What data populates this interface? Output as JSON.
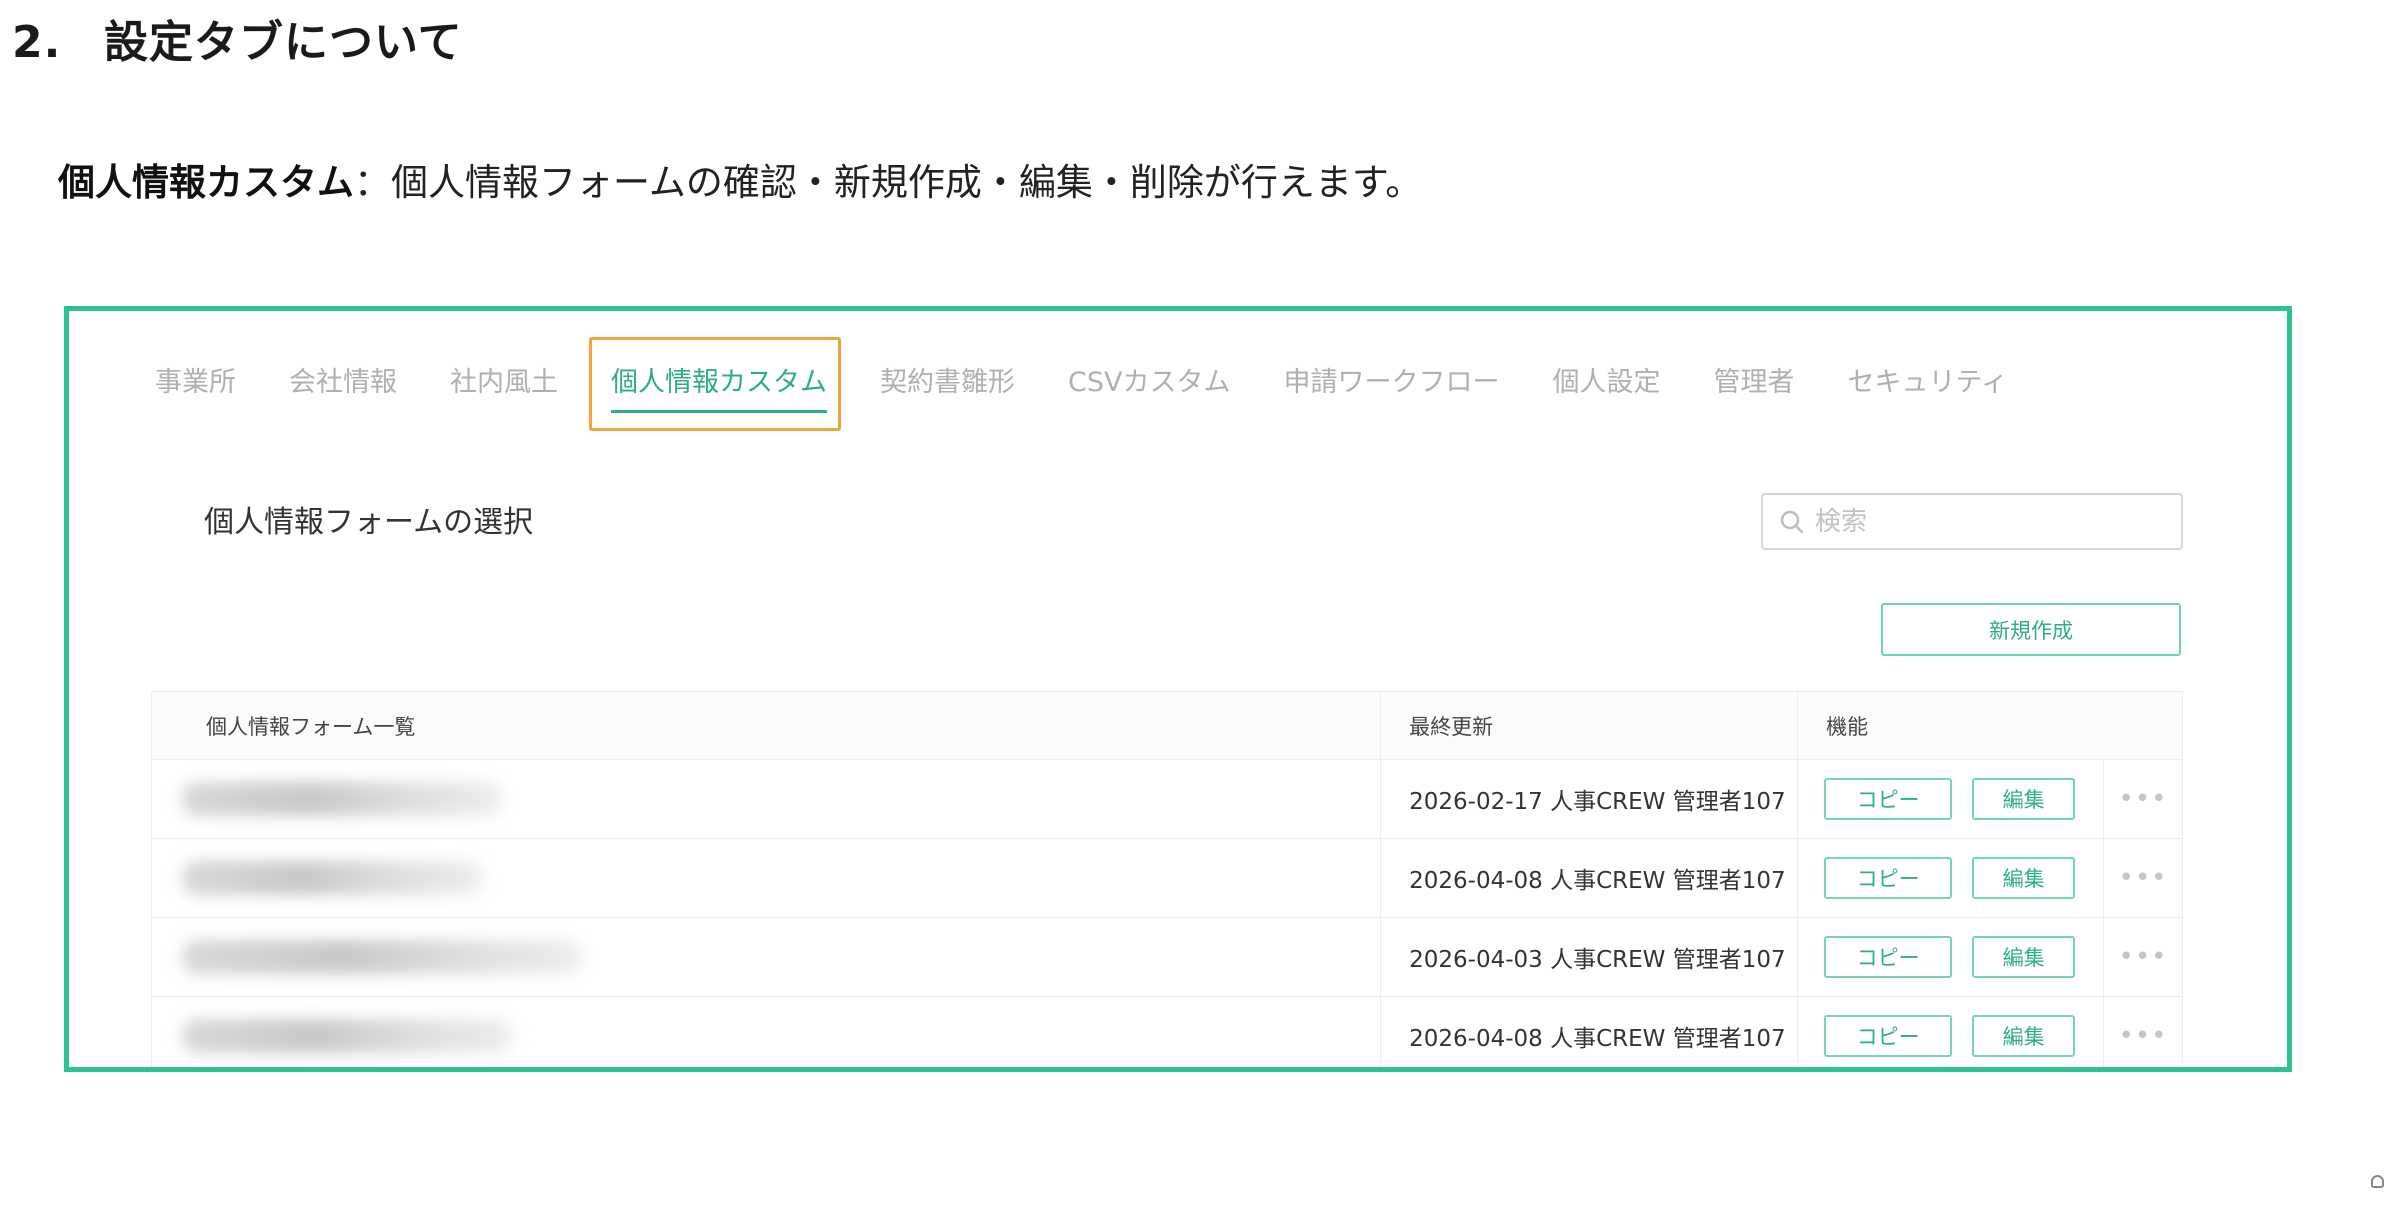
{
  "doc": {
    "heading_number": "2.",
    "heading_title": "設定タブについて",
    "description_bold": "個人情報カスタム",
    "description_rest": "：個人情報フォームの確認・新規作成・編集・削除が行えます。"
  },
  "tabs": [
    {
      "label": "事業所"
    },
    {
      "label": "会社情報"
    },
    {
      "label": "社内風土"
    },
    {
      "label": "個人情報カスタム",
      "active": true
    },
    {
      "label": "契約書雛形"
    },
    {
      "label": "CSVカスタム"
    },
    {
      "label": "申請ワークフロー"
    },
    {
      "label": "個人設定"
    },
    {
      "label": "管理者"
    },
    {
      "label": "セキュリティ"
    }
  ],
  "section": {
    "title": "個人情報フォームの選択"
  },
  "search": {
    "placeholder": "検索",
    "icon": "search-icon"
  },
  "new_button": {
    "label": "新規作成"
  },
  "table": {
    "headers": {
      "name": "個人情報フォーム一覧",
      "updated": "最終更新",
      "functions": "機能"
    },
    "rows": [
      {
        "updated": "2026-02-17 人事CREW 管理者107",
        "copy": "コピー",
        "edit": "編集"
      },
      {
        "updated": "2026-04-08 人事CREW 管理者107",
        "copy": "コピー",
        "edit": "編集"
      },
      {
        "updated": "2026-04-03 人事CREW 管理者107",
        "copy": "コピー",
        "edit": "編集"
      },
      {
        "updated": "2026-04-08 人事CREW 管理者107",
        "copy": "コピー",
        "edit": "編集"
      }
    ]
  },
  "colors": {
    "frame": "#2cc38f",
    "accent": "#2fae86",
    "tab_highlight": "#f2a43c",
    "inactive_tab": "#b0b0b0"
  }
}
